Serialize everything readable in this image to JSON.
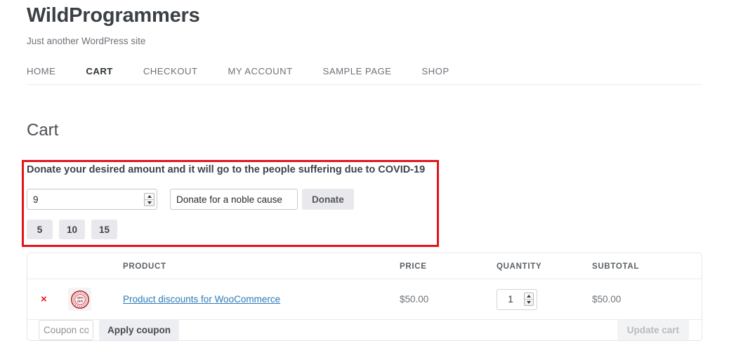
{
  "site": {
    "title": "WildProgrammers",
    "tagline": "Just another WordPress site"
  },
  "nav": {
    "items": [
      {
        "label": "HOME",
        "active": false
      },
      {
        "label": "CART",
        "active": true
      },
      {
        "label": "CHECKOUT",
        "active": false
      },
      {
        "label": "MY ACCOUNT",
        "active": false
      },
      {
        "label": "SAMPLE PAGE",
        "active": false
      },
      {
        "label": "SHOP",
        "active": false
      }
    ]
  },
  "page": {
    "title": "Cart"
  },
  "donation": {
    "heading": "Donate your desired amount and it will go to the people suffering due to COVID-19",
    "amount_value": "9",
    "amount_placeholder": "",
    "cause_value": "Donate for a noble cause",
    "cause_placeholder": "Donate for a noble cause",
    "donate_button": "Donate",
    "presets": [
      "5",
      "10",
      "15"
    ],
    "annotation_color": "#e3151c"
  },
  "cart": {
    "headers": {
      "product": "PRODUCT",
      "price": "PRICE",
      "quantity": "QUANTITY",
      "subtotal": "SUBTOTAL"
    },
    "rows": [
      {
        "remove_label": "×",
        "thumb_text": "% OFF",
        "name": "Product discounts for WooCommerce",
        "price": "$50.00",
        "quantity": "1",
        "subtotal": "$50.00"
      }
    ],
    "coupon_placeholder": "Coupon co",
    "coupon_value": "",
    "apply_coupon_button": "Apply coupon",
    "update_cart_button": "Update cart"
  }
}
